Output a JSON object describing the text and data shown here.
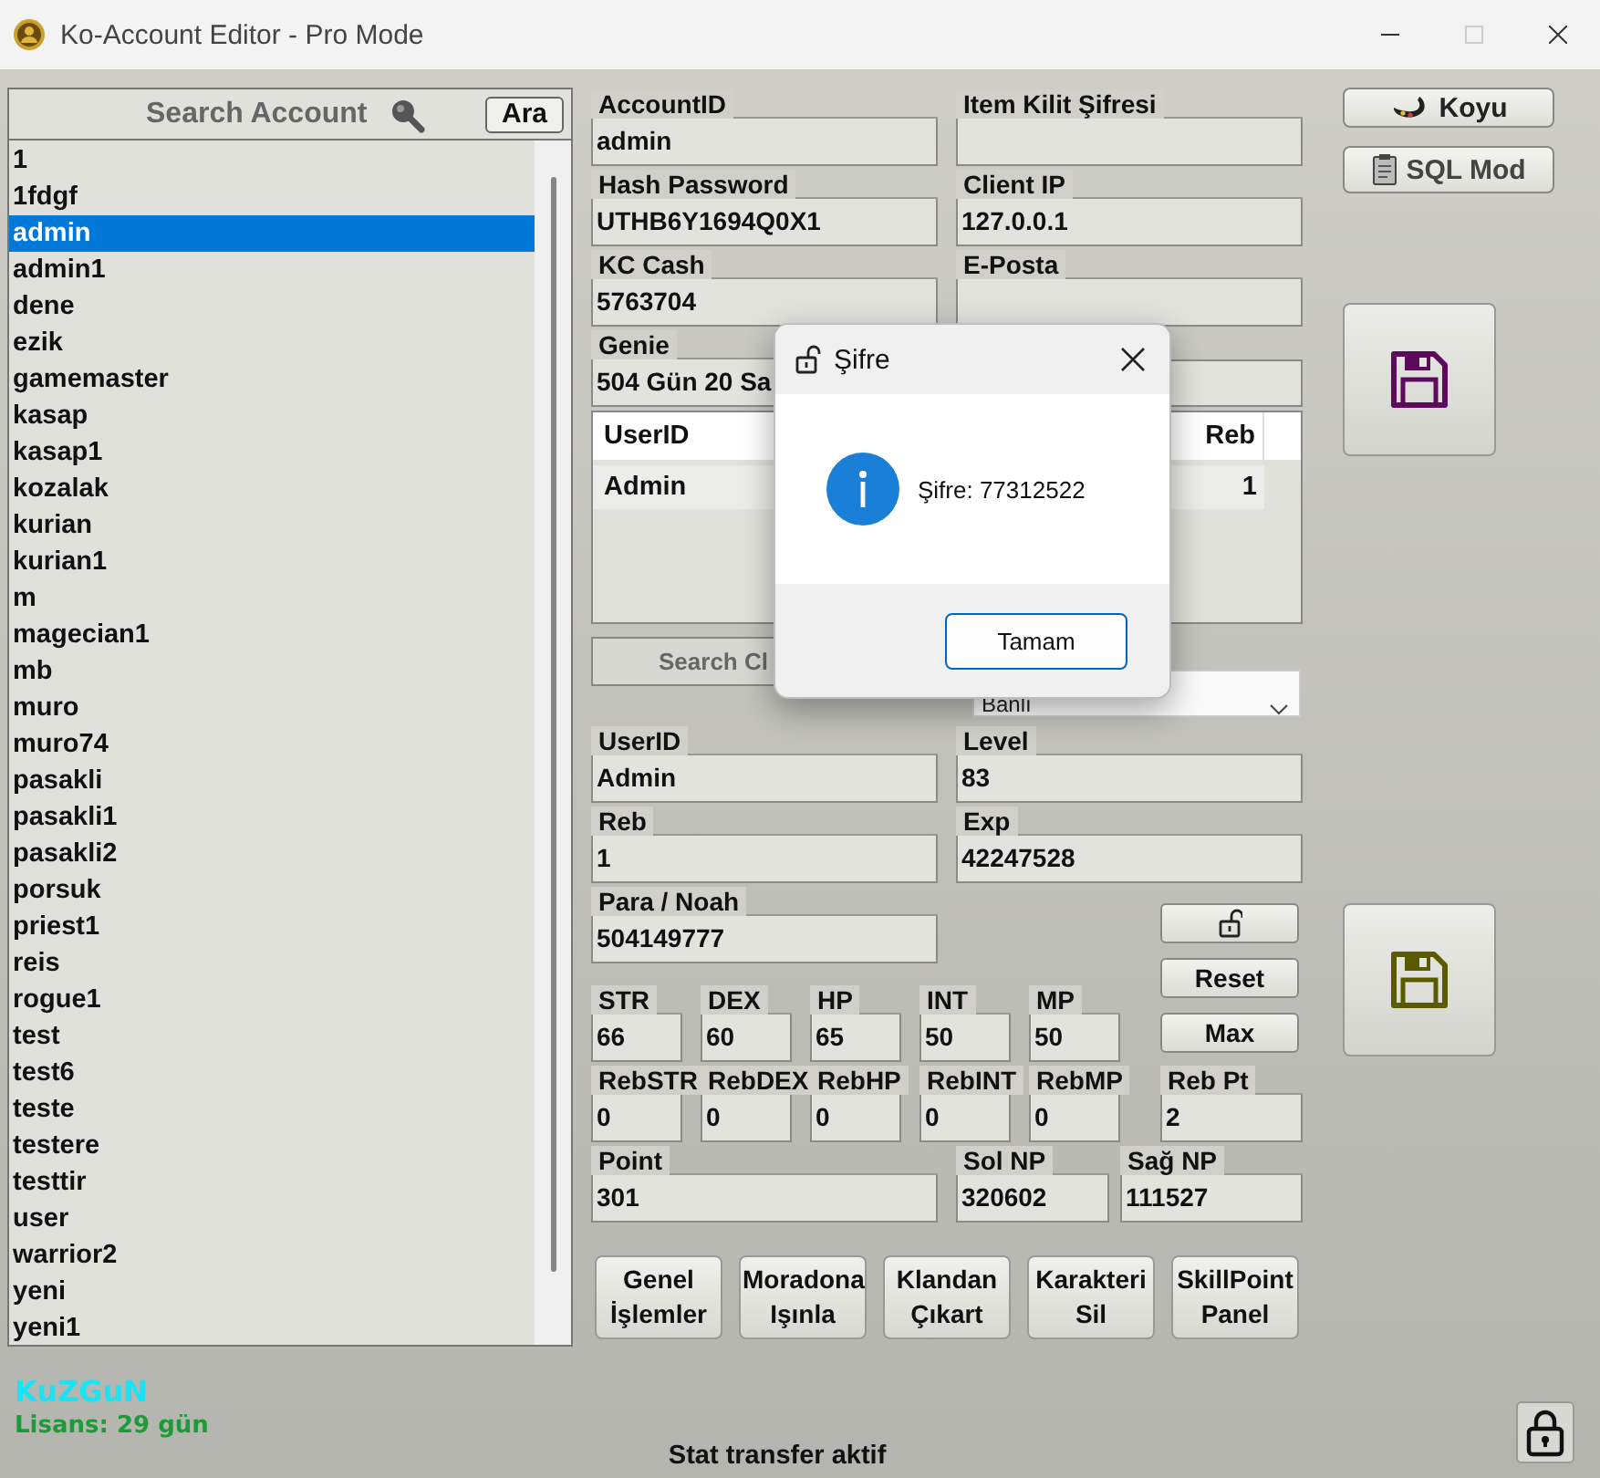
{
  "window": {
    "title": "Ko-Account Editor - Pro Mode"
  },
  "search": {
    "label": "Search Account",
    "button": "Ara"
  },
  "accounts": [
    {
      "name": "1",
      "selected": false
    },
    {
      "name": "1fdgf",
      "selected": false
    },
    {
      "name": "admin",
      "selected": true
    },
    {
      "name": "admin1",
      "selected": false
    },
    {
      "name": "dene",
      "selected": false
    },
    {
      "name": "ezik",
      "selected": false
    },
    {
      "name": "gamemaster",
      "selected": false
    },
    {
      "name": "kasap",
      "selected": false
    },
    {
      "name": "kasap1",
      "selected": false
    },
    {
      "name": "kozalak",
      "selected": false
    },
    {
      "name": "kurian",
      "selected": false
    },
    {
      "name": "kurian1",
      "selected": false
    },
    {
      "name": "m",
      "selected": false
    },
    {
      "name": "magecian1",
      "selected": false
    },
    {
      "name": "mb",
      "selected": false
    },
    {
      "name": "muro",
      "selected": false
    },
    {
      "name": "muro74",
      "selected": false
    },
    {
      "name": "pasakli",
      "selected": false
    },
    {
      "name": "pasakli1",
      "selected": false
    },
    {
      "name": "pasakli2",
      "selected": false
    },
    {
      "name": "porsuk",
      "selected": false
    },
    {
      "name": "priest1",
      "selected": false
    },
    {
      "name": "reis",
      "selected": false
    },
    {
      "name": "rogue1",
      "selected": false
    },
    {
      "name": "test",
      "selected": false
    },
    {
      "name": "test6",
      "selected": false
    },
    {
      "name": "teste",
      "selected": false
    },
    {
      "name": "testere",
      "selected": false
    },
    {
      "name": "testtir",
      "selected": false
    },
    {
      "name": "user",
      "selected": false
    },
    {
      "name": "warrior2",
      "selected": false
    },
    {
      "name": "yeni",
      "selected": false
    },
    {
      "name": "yeni1",
      "selected": false
    }
  ],
  "account_fields": [
    {
      "label": "AccountID",
      "value": "admin"
    },
    {
      "label": "Item Kilit Şifresi"
    },
    {
      "label": "Hash Password",
      "value": "UTHB6Y1694Q0X1"
    },
    {
      "label": "Client IP",
      "value": "127.0.0.1"
    },
    {
      "label": "KC Cash",
      "value": "5763704"
    },
    {
      "label": "E-Posta"
    },
    {
      "label": "Genie",
      "value": "504 Gün 20 Sa"
    }
  ],
  "characters": {
    "columns": [
      "UserID",
      "Reb"
    ],
    "rows": [
      [
        "Admin",
        "1"
      ]
    ]
  },
  "search_character": {
    "label": "Search Cl"
  },
  "status_dropdown": {
    "value": "Banlı"
  },
  "character_fields": [
    {
      "label": "UserID",
      "value": "Admin"
    },
    {
      "label": "Level",
      "value": "83"
    },
    {
      "label": "Reb",
      "value": "1"
    },
    {
      "label": "Exp",
      "value": "42247528"
    }
  ],
  "money": {
    "label": "Para / Noah",
    "value": "504149777"
  },
  "stat_buttons": [
    "Reset",
    "Max"
  ],
  "stats": [
    {
      "label": "STR",
      "value": "66"
    },
    {
      "label": "DEX",
      "value": "60"
    },
    {
      "label": "HP",
      "value": "65"
    },
    {
      "label": "INT",
      "value": "50"
    },
    {
      "label": "MP",
      "value": "50"
    }
  ],
  "reb_stats": [
    {
      "label": "RebSTR",
      "value": "0"
    },
    {
      "label": "RebDEX",
      "value": "0"
    },
    {
      "label": "RebHP",
      "value": "0"
    },
    {
      "label": "RebINT",
      "value": "0"
    },
    {
      "label": "RebMP",
      "value": "0"
    }
  ],
  "reb_points": {
    "label": "Reb Pt",
    "value": "2"
  },
  "points": [
    {
      "label": "Point",
      "value": "301"
    },
    {
      "label": "Sol NP",
      "value": "320602"
    },
    {
      "label": "Sağ NP",
      "value": "111527"
    }
  ],
  "actions": [
    "Genel İşlemler",
    "Moradona Işınla",
    "Klandan Çıkart",
    "Karakteri Sil",
    "SkillPoint Panel"
  ],
  "tool_buttons": [
    "Koyu",
    "SQL Mod"
  ],
  "footer": {
    "user": "KuZGuN",
    "license": "Lisans: 29 gün",
    "status": "Stat transfer aktif"
  },
  "dialog": {
    "title": "Şifre",
    "message": "Şifre: 77312522",
    "button": "Tamam"
  }
}
